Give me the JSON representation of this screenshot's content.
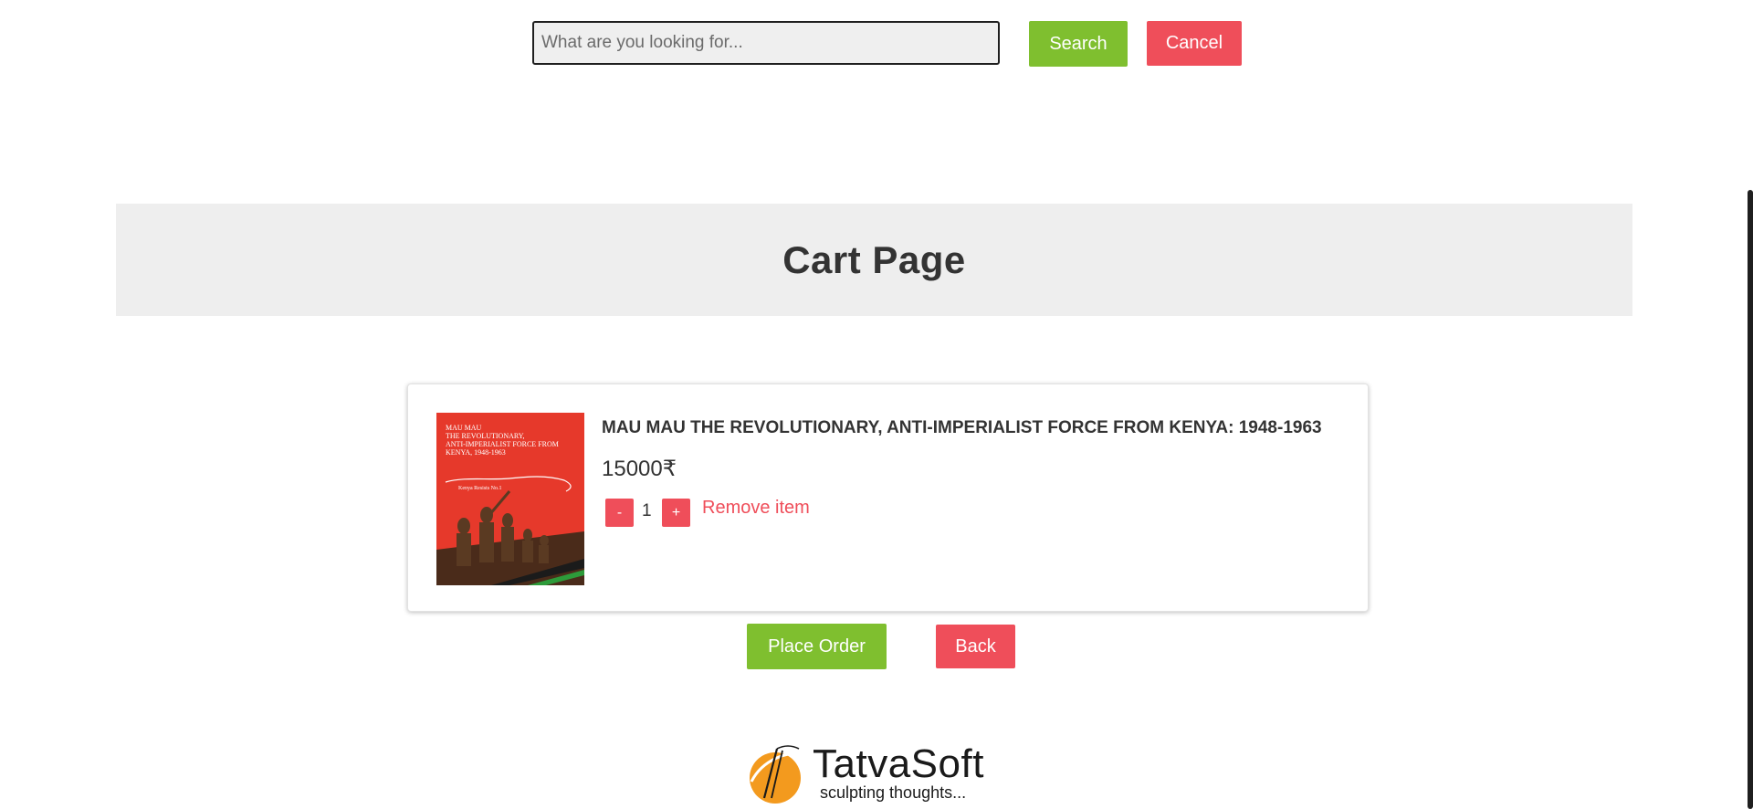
{
  "search": {
    "placeholder": "What are you looking for...",
    "value": "",
    "search_label": "Search",
    "cancel_label": "Cancel"
  },
  "header": {
    "title": "Cart Page"
  },
  "cart": {
    "items": [
      {
        "title": "MAU MAU THE REVOLUTIONARY, ANTI-IMPERIALIST FORCE FROM KENYA: 1948-1963",
        "price": "15000₹",
        "quantity": "1",
        "decrement_label": "-",
        "increment_label": "+",
        "remove_label": "Remove item",
        "cover": {
          "title_text": "MAU MAU\nTHE REVOLUTIONARY,\nANTI-IMPERIALIST FORCE FROM\nKENYA, 1948-1963",
          "series_text": "Kenya Resists No.1",
          "color": "#e6392b"
        }
      }
    ]
  },
  "actions": {
    "place_order_label": "Place Order",
    "back_label": "Back"
  },
  "footer": {
    "brand_name": "TatvaSoft",
    "tagline": "sculpting thoughts..."
  },
  "colors": {
    "accent_green": "#7fbf2f",
    "accent_red": "#ef4e5a",
    "header_band": "#eeeeee"
  }
}
